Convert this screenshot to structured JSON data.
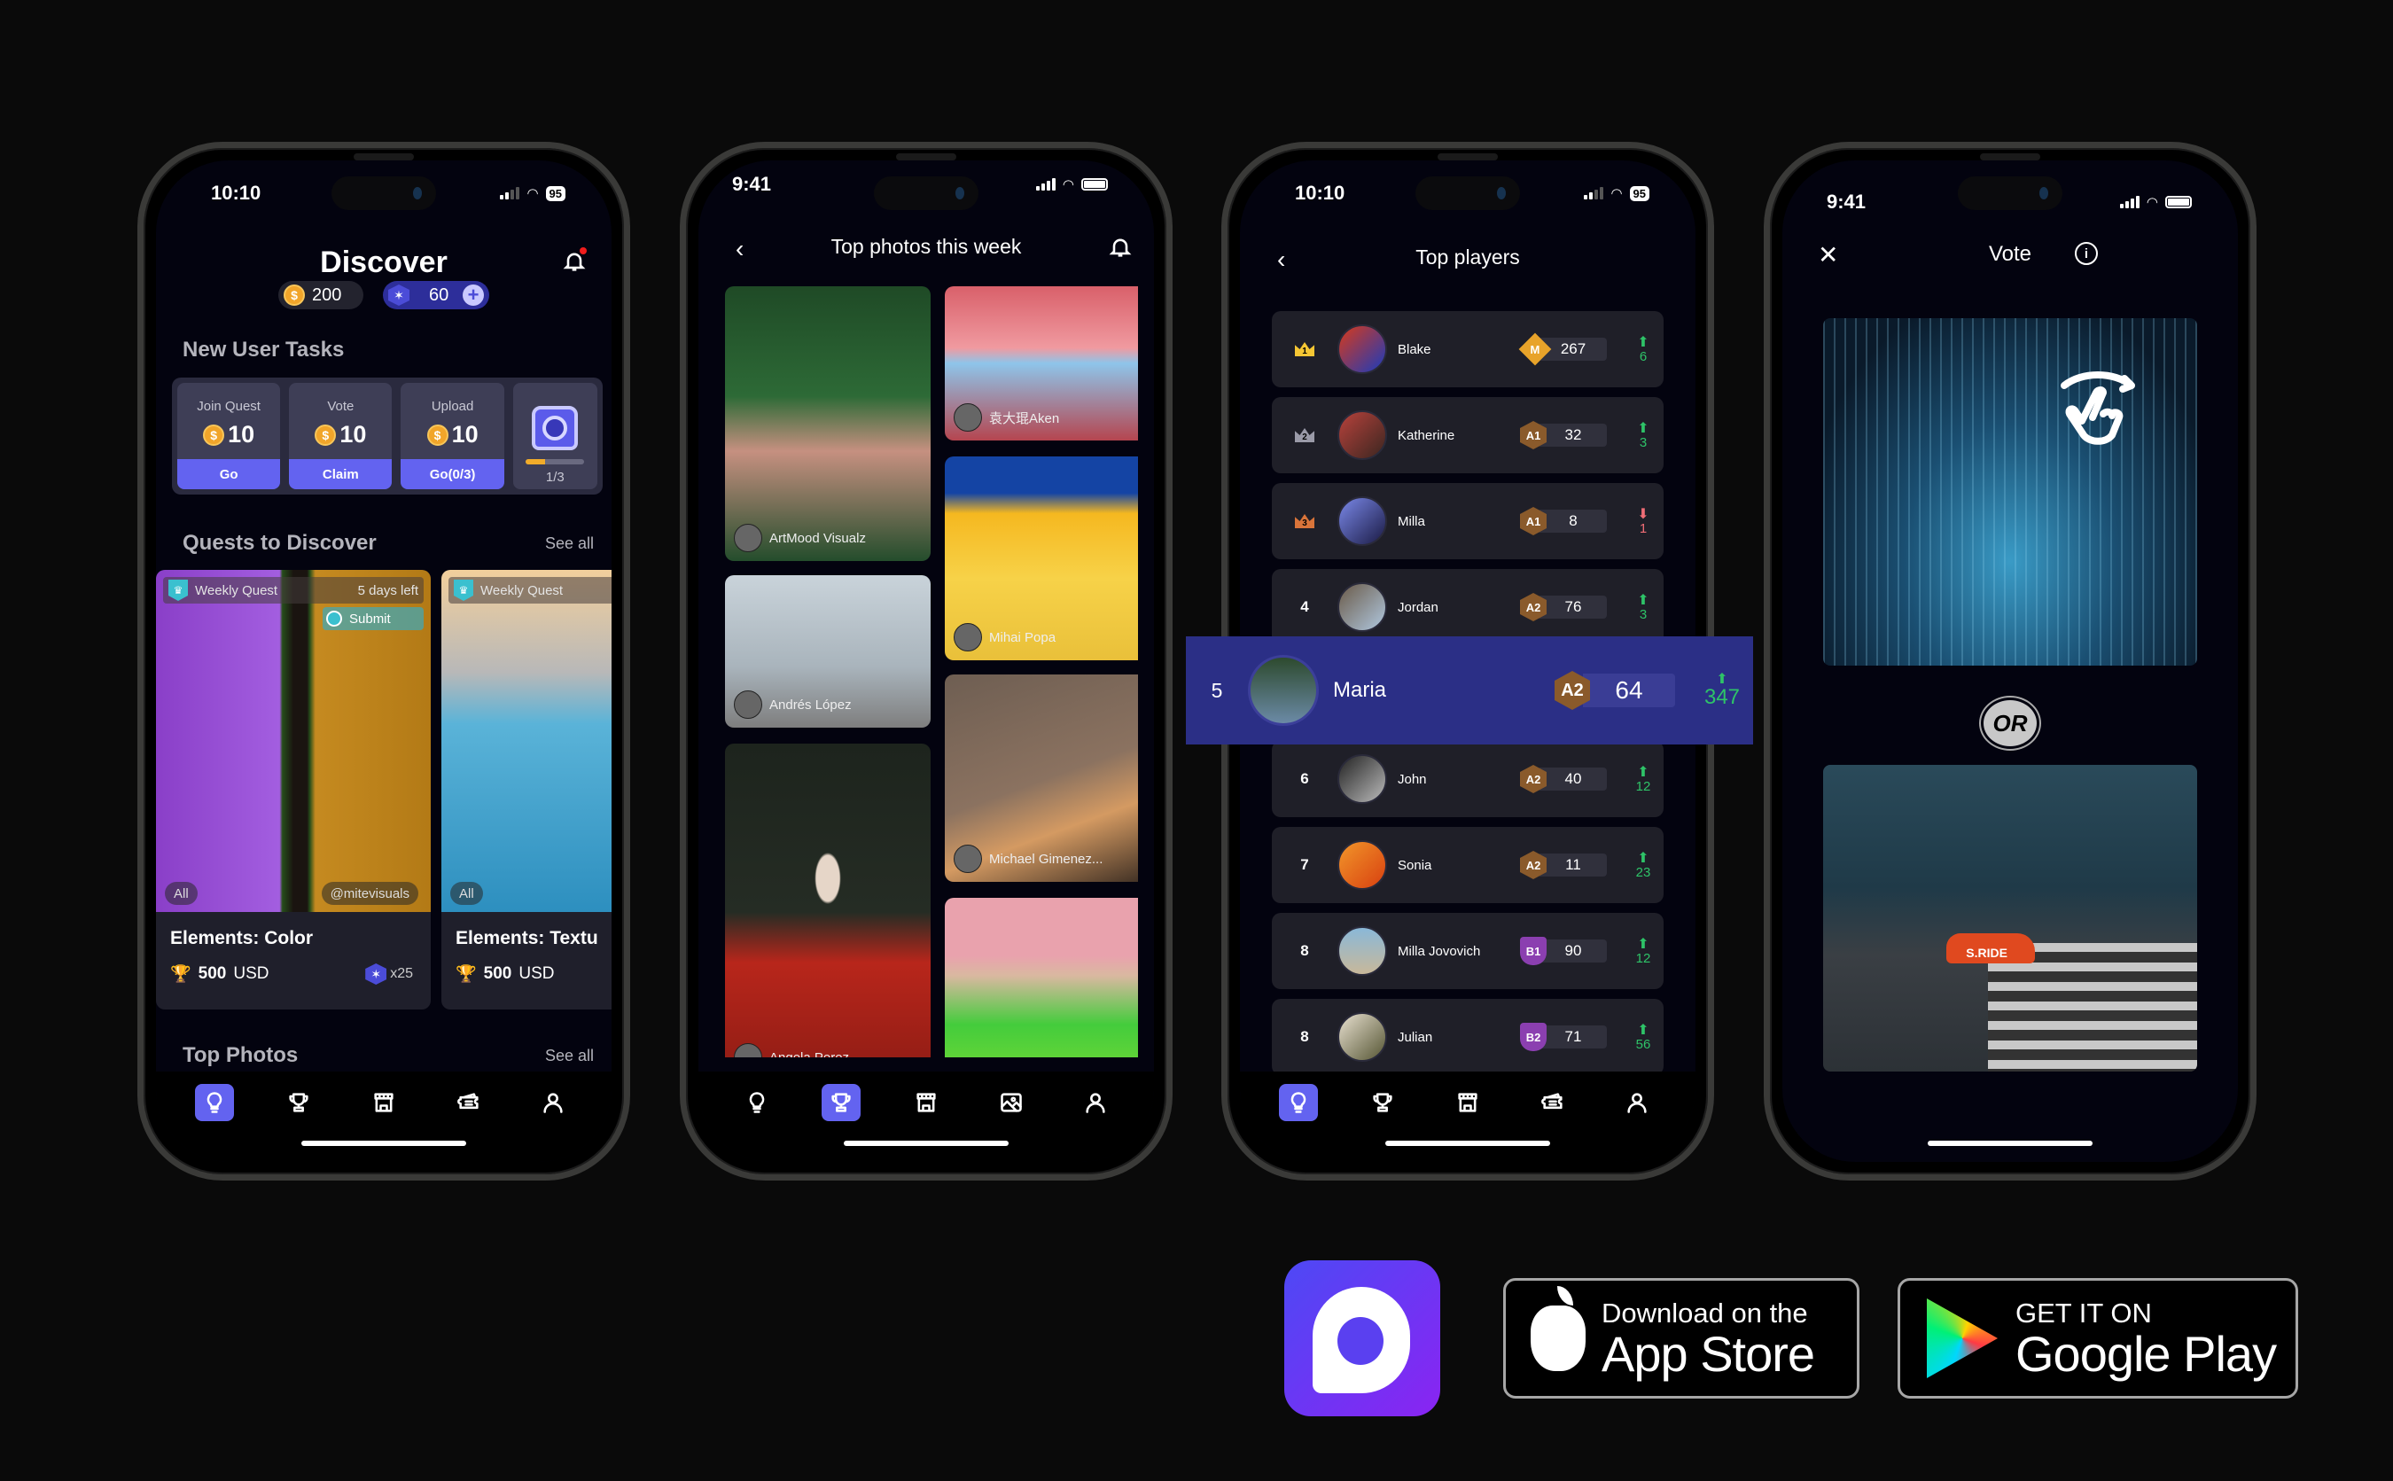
{
  "colors": {
    "accent": "#6363f0",
    "background": "#0a0a0a",
    "screen": "#03030f",
    "up": "#2ec368",
    "down": "#f06d76",
    "highlight": "#2b2f86",
    "coin": "#f1a52a"
  },
  "phones": {
    "discover": {
      "status": {
        "time": "10:10",
        "battery": "95"
      },
      "title": "Discover",
      "coins": "200",
      "gems": "60",
      "new_user_tasks": {
        "title": "New User Tasks",
        "tasks": [
          {
            "label": "Join Quest",
            "reward": "10",
            "button": "Go"
          },
          {
            "label": "Vote",
            "reward": "10",
            "button": "Claim"
          },
          {
            "label": "Upload",
            "reward": "10",
            "button": "Go(0/3)"
          }
        ],
        "chest_progress": "1/3",
        "chest_progress_fraction": 0.33
      },
      "quests_section": {
        "title": "Quests to Discover",
        "see_all": "See all"
      },
      "quests": [
        {
          "badge": "Weekly Quest",
          "time_left": "5 days left",
          "submit": "Submit",
          "category": "All",
          "author": "@mitevisuals",
          "name": "Elements: Color",
          "prize_amount": "500",
          "prize_currency": "USD",
          "multiplier": "x25"
        },
        {
          "badge": "Weekly Quest",
          "category": "All",
          "name": "Elements: Textu",
          "prize_amount": "500",
          "prize_currency": "USD"
        }
      ],
      "top_photos": {
        "title": "Top Photos",
        "see_all": "See all"
      },
      "tabs": [
        "discover-bulb",
        "trophy",
        "store",
        "ticket",
        "profile"
      ],
      "active_tab": 0
    },
    "top_photos": {
      "status": {
        "time": "9:41"
      },
      "title": "Top photos this week",
      "photos": [
        {
          "author": "ArtMood Visualz"
        },
        {
          "author": "袁大琨Aken"
        },
        {
          "author": "Mihai Popa"
        },
        {
          "author": "Andrés López"
        },
        {
          "author": "Michael Gimenez..."
        },
        {
          "author": "Angela Perez"
        },
        {
          "author": ""
        }
      ],
      "tabs": [
        "discover-bulb",
        "trophy",
        "store",
        "image",
        "profile"
      ],
      "active_tab": 1
    },
    "top_players": {
      "status": {
        "time": "10:10",
        "battery": "95"
      },
      "title": "Top players",
      "players": [
        {
          "rank": "1",
          "name": "Blake",
          "level": "M",
          "score": "267",
          "change": "6",
          "direction": "up"
        },
        {
          "rank": "2",
          "name": "Katherine",
          "level": "A1",
          "score": "32",
          "change": "3",
          "direction": "up"
        },
        {
          "rank": "3",
          "name": "Milla",
          "level": "A1",
          "score": "8",
          "change": "1",
          "direction": "down"
        },
        {
          "rank": "4",
          "name": "Jordan",
          "level": "A2",
          "score": "76",
          "change": "3",
          "direction": "up"
        },
        {
          "rank": "6",
          "name": "John",
          "level": "A2",
          "score": "40",
          "change": "12",
          "direction": "up"
        },
        {
          "rank": "7",
          "name": "Sonia",
          "level": "A2",
          "score": "11",
          "change": "23",
          "direction": "up"
        },
        {
          "rank": "8",
          "name": "Milla Jovovich",
          "level": "B1",
          "score": "90",
          "change": "12",
          "direction": "up"
        },
        {
          "rank": "8",
          "name": "Julian",
          "level": "B2",
          "score": "71",
          "change": "56",
          "direction": "up"
        }
      ],
      "current_user": {
        "rank": "5",
        "name": "Maria",
        "level": "A2",
        "score": "64",
        "change": "347",
        "direction": "up"
      },
      "tabs": [
        "discover-bulb",
        "trophy",
        "store",
        "ticket",
        "profile"
      ],
      "active_tab": 0
    },
    "vote": {
      "status": {
        "time": "9:41"
      },
      "title": "Vote",
      "or_label": "OR",
      "taxi_text": "S.RIDE"
    }
  },
  "store_badges": {
    "apple": {
      "small": "Download on the",
      "big": "App Store"
    },
    "google": {
      "small": "GET IT ON",
      "big": "Google Play"
    }
  }
}
